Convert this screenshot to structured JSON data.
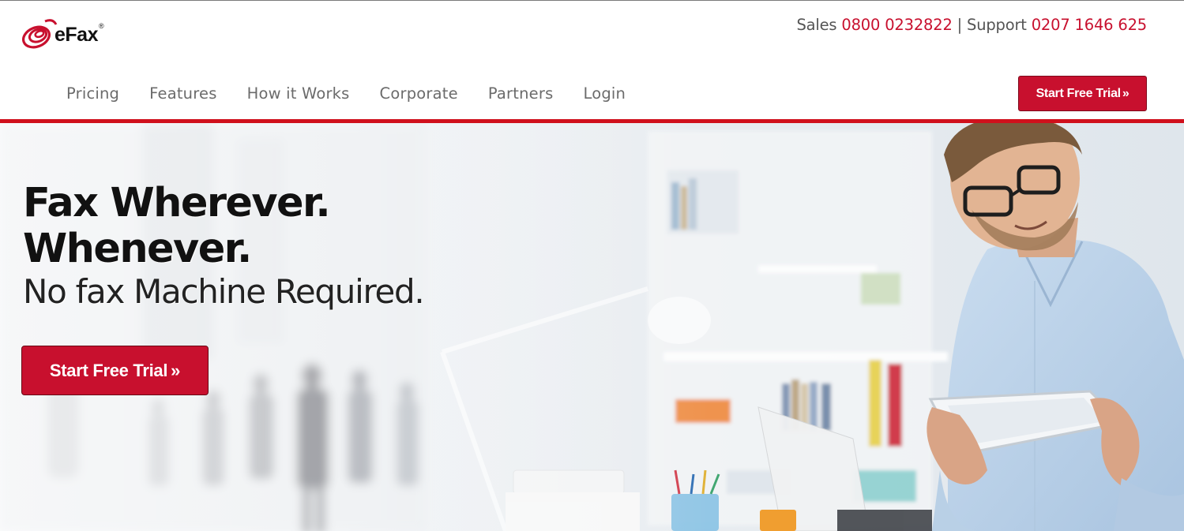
{
  "brand": {
    "name": "eFax",
    "registered_mark": "®",
    "accent_color": "#c8102e"
  },
  "contact": {
    "sales_label": "Sales",
    "sales_phone": "0800 0232822",
    "separator": "|",
    "support_label": "Support",
    "support_phone": "0207 1646 625"
  },
  "nav": {
    "items": [
      {
        "label": "Pricing"
      },
      {
        "label": "Features"
      },
      {
        "label": "How it Works"
      },
      {
        "label": "Corporate"
      },
      {
        "label": "Partners"
      },
      {
        "label": "Login"
      }
    ]
  },
  "header_cta": {
    "label": "Start Free Trial",
    "icon": "double-chevron-right-icon",
    "glyph": "»"
  },
  "hero": {
    "headline_line1": "Fax Wherever.",
    "headline_line2": "Whenever.",
    "subheadline": "No fax Machine Required.",
    "cta_label": "Start Free Trial",
    "cta_glyph": "»",
    "image": "man-with-tablet-in-office-photo"
  }
}
